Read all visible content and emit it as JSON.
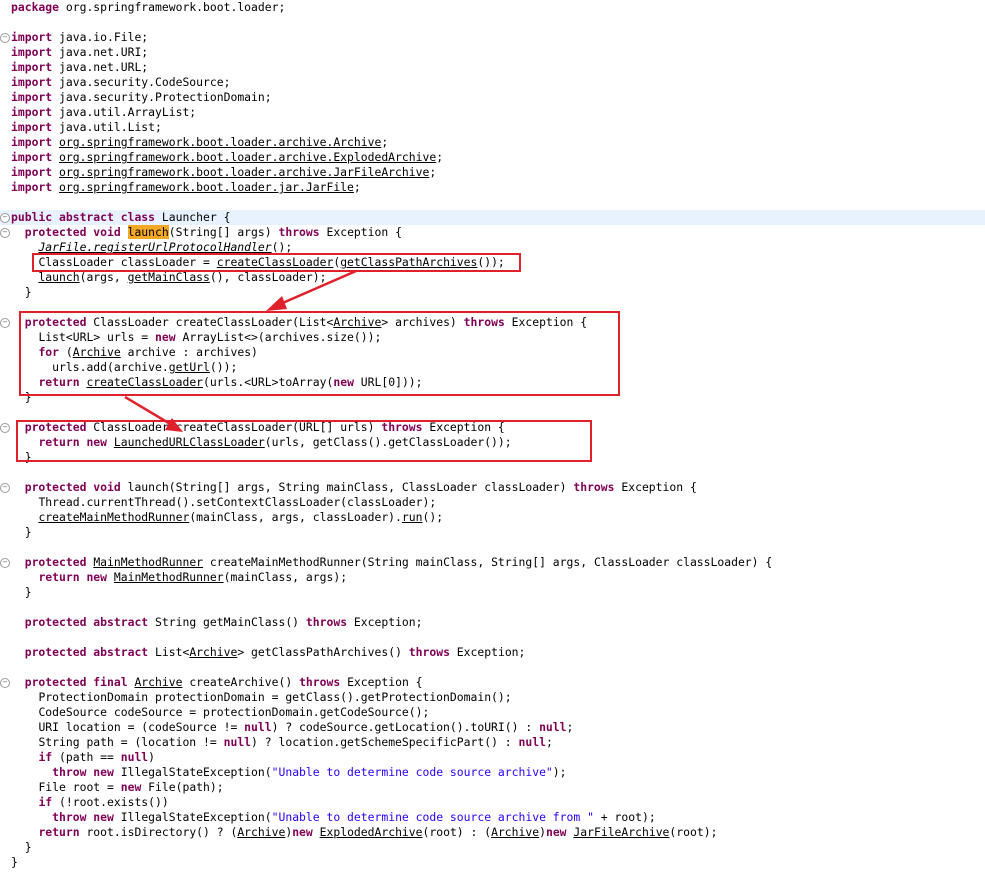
{
  "colors": {
    "keyword": "#7f0055",
    "string": "#2a00ff",
    "highlight": "#f5a823",
    "current_line": "#e8f2fe",
    "annotation": "#e0202a"
  },
  "code": {
    "l01_a": "package",
    "l01_b": " org.springframework.boot.loader;",
    "kw_import": "import",
    "l03": " java.io.File;",
    "l04": " java.net.URI;",
    "l05": " java.net.URL;",
    "l06": " java.security.CodeSource;",
    "l07": " java.security.ProtectionDomain;",
    "l08": " java.util.ArrayList;",
    "l09": " java.util.List;",
    "l10": "org.springframework.boot.loader.archive.Archive",
    "l11": "org.springframework.boot.loader.archive.ExplodedArchive",
    "l12": "org.springframework.boot.loader.archive.JarFileArchive",
    "l13": "org.springframework.boot.loader.jar.JarFile",
    "l15_kw": "public abstract class",
    "l15_rest": " Launcher {",
    "l16_kw": "protected void",
    "l16_hl": "launch",
    "l16_mid": "(String[] args) ",
    "l16_kw2": "throws",
    "l16_end": " Exception {",
    "l17_u": "JarFile.registerUrlProtocolHandler",
    "l17_end": "();",
    "l18_a": "ClassLoader classLoader = ",
    "l18_u1": "createClassLoader",
    "l18_b": "(",
    "l18_u2": "getClassPathArchives",
    "l18_c": "());",
    "l19_u1": "launch",
    "l19_a": "(args, ",
    "l19_u2": "getMainClass",
    "l19_b": "(), classLoader);",
    "close_brace": "}",
    "l21_kw": "protected",
    "l21_a": " ClassLoader createClassLoader(List<",
    "l21_u": "Archive",
    "l21_b": "> archives) ",
    "l21_kw2": "throws",
    "l21_c": " Exception {",
    "l22_a": "List<URL> urls = ",
    "l22_kw": "new",
    "l22_b": " ArrayList<>(archives.size());",
    "l23_kw": "for",
    "l23_a": " (",
    "l23_u": "Archive",
    "l23_b": " archive : archives)",
    "l24_a": "urls.add(archive.",
    "l24_u": "getUrl",
    "l24_b": "());",
    "l25_kw": "return",
    "l25_u": "createClassLoader",
    "l25_a": "(urls.<URL>toArray(",
    "l25_kw2": "new",
    "l25_b": " URL[0]));",
    "l28_kw": "protected",
    "l28_a": " ClassLoader createClassLoader(URL[] urls) ",
    "l28_kw2": "throws",
    "l28_b": " Exception {",
    "l29_kw": "return new",
    "l29_u": "LaunchedURLClassLoader",
    "l29_a": "(urls, getClass().getClassLoader());",
    "l32_kw": "protected void",
    "l32_a": " launch(String[] args, String mainClass, ClassLoader classLoader) ",
    "l32_kw2": "throws",
    "l32_b": " Exception {",
    "l33": "Thread.currentThread().setContextClassLoader(classLoader);",
    "l34_u1": "createMainMethodRunner",
    "l34_a": "(mainClass, args, classLoader).",
    "l34_u2": "run",
    "l34_b": "();",
    "l37_kw": "protected",
    "l37_u": "MainMethodRunner",
    "l37_a": " createMainMethodRunner(String mainClass, String[] args, ClassLoader classLoader) {",
    "l38_kw": "return new",
    "l38_u": "MainMethodRunner",
    "l38_a": "(mainClass, args);",
    "l41_kw": "protected abstract",
    "l41_a": " String getMainClass() ",
    "l41_kw2": "throws",
    "l41_b": " Exception;",
    "l43_kw": "protected abstract",
    "l43_a": " List<",
    "l43_u": "Archive",
    "l43_b": "> getClassPathArchives() ",
    "l43_kw2": "throws",
    "l43_c": " Exception;",
    "l45_kw": "protected final",
    "l45_u": "Archive",
    "l45_a": " createArchive() ",
    "l45_kw2": "throws",
    "l45_b": " Exception {",
    "l46": "ProtectionDomain protectionDomain = getClass().getProtectionDomain();",
    "l47": "CodeSource codeSource = protectionDomain.getCodeSource();",
    "l48_a": "URI location = (codeSource != ",
    "kw_null": "null",
    "l48_b": ") ? codeSource.getLocation().toURI() : ",
    "l48_c": ";",
    "l49_a": "String path = (location != ",
    "l49_b": ") ? location.getSchemeSpecificPart() : ",
    "l49_c": ";",
    "kw_if": "if",
    "l50_a": " (path == ",
    "l50_b": ")",
    "kw_throw_new": "throw new",
    "l51_a": " IllegalStateException(",
    "l51_str": "\"Unable to determine code source archive\"",
    "l51_b": ");",
    "l52_a": "File root = ",
    "kw_new": "new",
    "l52_b": " File(path);",
    "l53_a": " (!root.exists())",
    "l54_str": "\"Unable to determine code source archive from \"",
    "l54_b": " + root);",
    "kw_return": "return",
    "l55_a": " root.isDirectory() ? (",
    "l55_u1": "Archive",
    "l55_b": ")",
    "l55_u2": "ExplodedArchive",
    "l55_c": "(root) : (",
    "l55_u3": "Archive",
    "l55_d": ")",
    "l55_u4": "JarFileArchive",
    "l55_e": "(root);"
  }
}
